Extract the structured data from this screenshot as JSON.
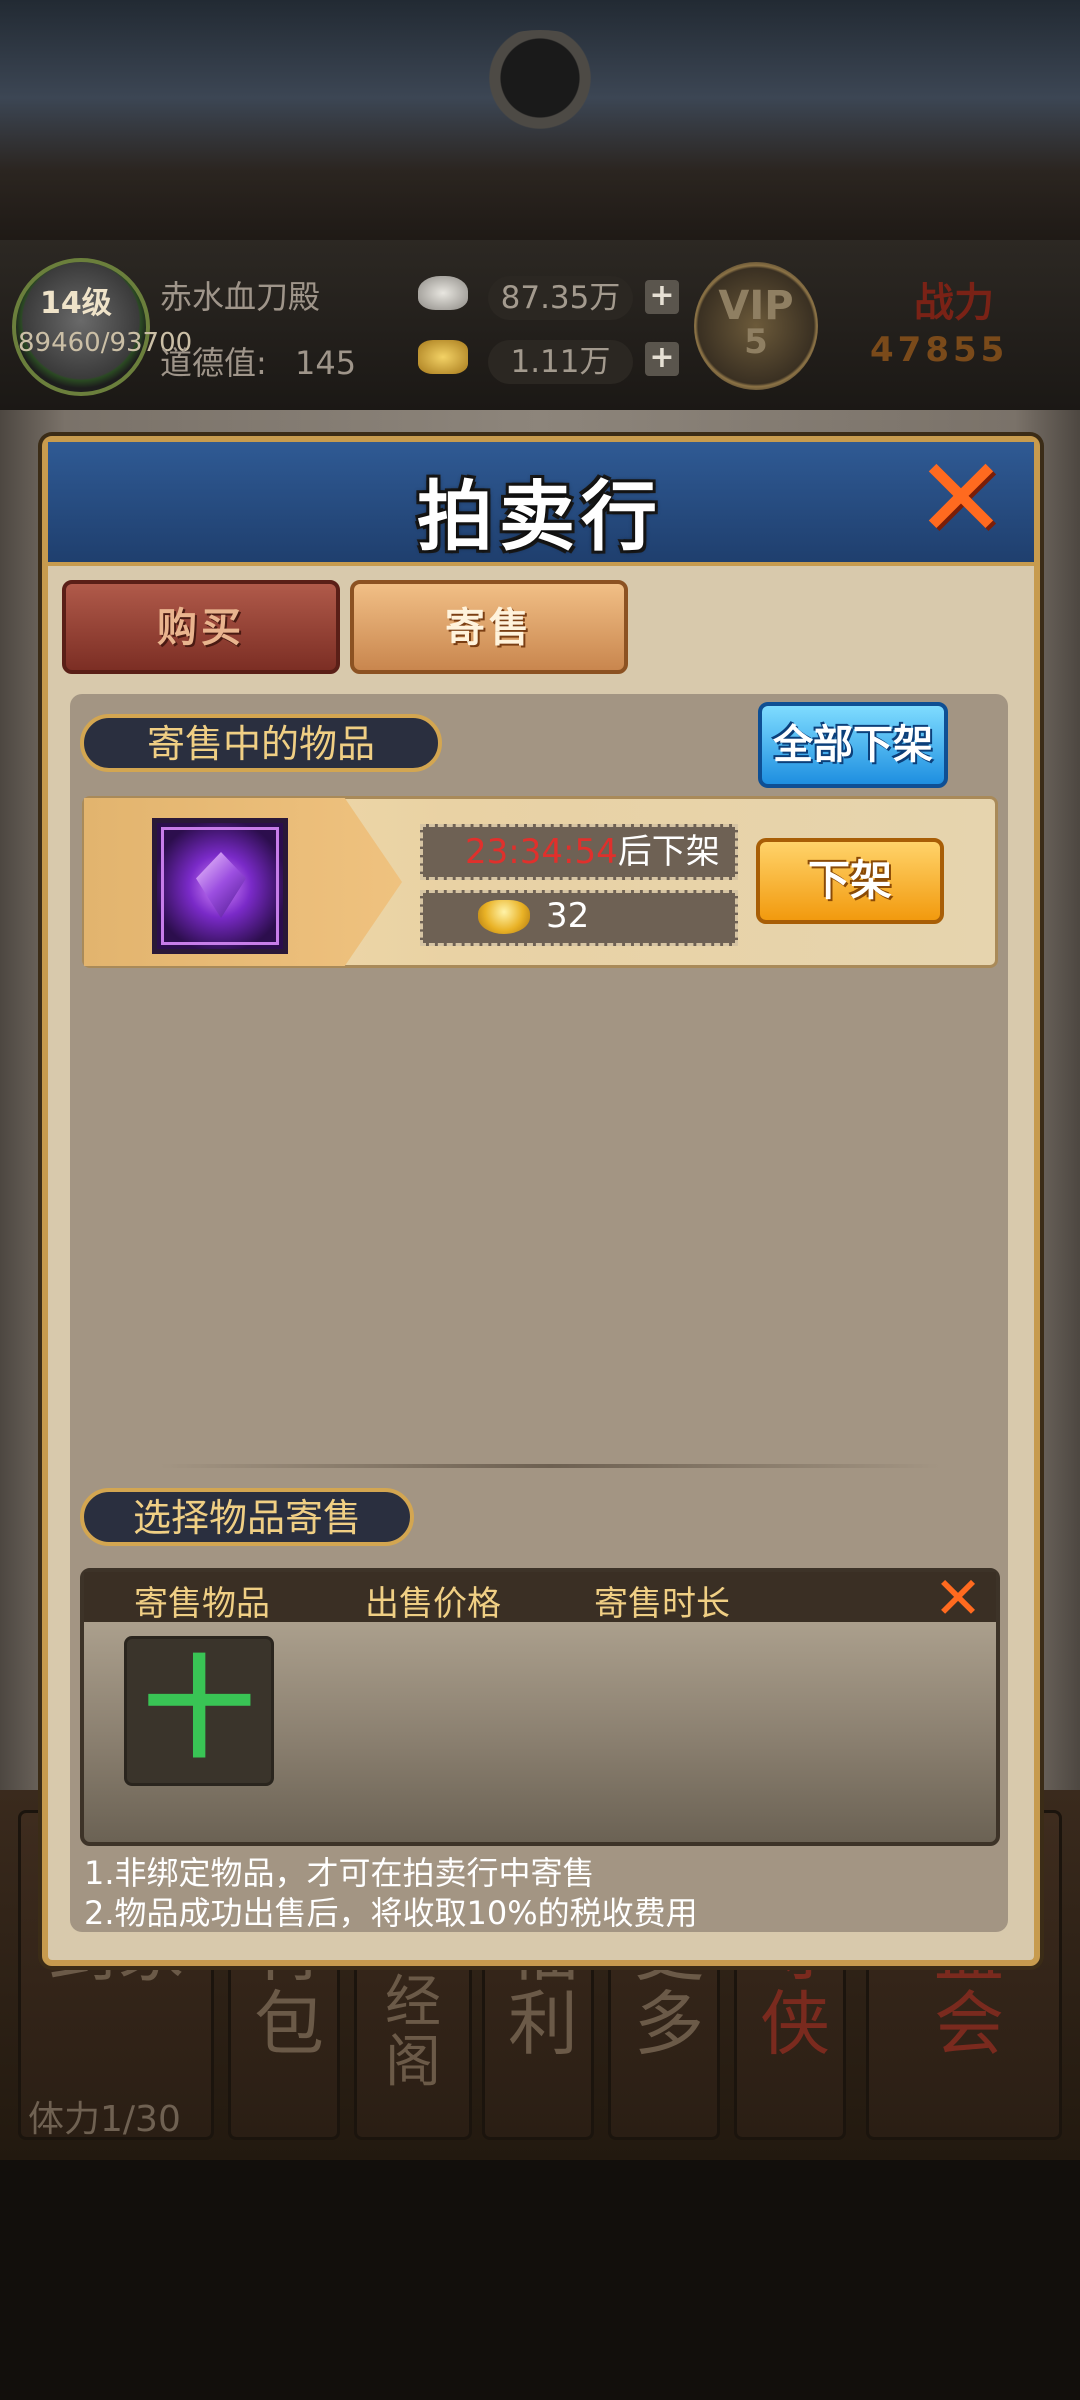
{
  "header": {
    "level": "14级",
    "exp": "89460/93700",
    "player_name": "赤水血刀殿",
    "morality_label": "道德值:",
    "morality_value": "145",
    "silver": "87.35万",
    "gold": "1.11万",
    "vip_label": "VIP",
    "vip_level": "5",
    "power_label": "战力",
    "power_value": "47855"
  },
  "dialog": {
    "title": "拍卖行",
    "tabs": [
      {
        "label": "购买",
        "active": false
      },
      {
        "label": "寄售",
        "active": true
      }
    ],
    "listed_section": {
      "label": "寄售中的物品",
      "remove_all_button": "全部下架",
      "items": [
        {
          "icon": "purple-crystal-icon",
          "timer": "23:34:54",
          "timer_suffix": "后下架",
          "price": "32",
          "remove_button": "下架"
        }
      ]
    },
    "select_section": {
      "label": "选择物品寄售",
      "columns": [
        "寄售物品",
        "出售价格",
        "寄售时长"
      ],
      "add_symbol": "十"
    },
    "notes": [
      "1.非绑定物品，才可在拍卖行中寄售",
      "2.物品成功出售后，将收取10%的税收费用"
    ]
  },
  "bottom_menu": {
    "stamina": "体力1/30",
    "tabs": [
      "剑冢",
      "背包",
      "藏经阁",
      "福利",
      "更多",
      "寻侠",
      "盟会"
    ]
  },
  "colors": {
    "accent_gold": "#c79b4e",
    "timer_red": "#e0302c",
    "remove_all_blue": "#1e8fe0",
    "remove_orange": "#f29a0e",
    "add_green": "#39c455"
  }
}
